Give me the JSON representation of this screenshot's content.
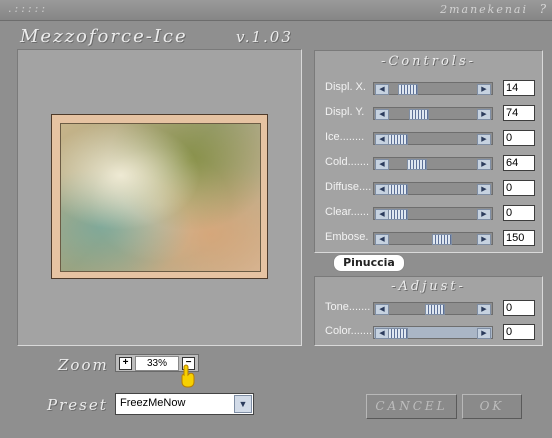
{
  "titlebar": {
    "dots": ".:::::",
    "author": "2manekenai",
    "help_symbol": "?"
  },
  "app": {
    "title": "Mezzoforce-Ice",
    "version": "v.1.03"
  },
  "controls": {
    "title": "-Controls-",
    "rows": [
      {
        "label": "Displ. X.",
        "value": "14",
        "level": 0.14
      },
      {
        "label": "Displ. Y.",
        "value": "74",
        "level": 0.29
      },
      {
        "label": "Ice........",
        "value": "0",
        "level": 0.0
      },
      {
        "label": "Cold.......",
        "value": "64",
        "level": 0.25
      },
      {
        "label": "Diffuse....",
        "value": "0",
        "level": 0.0
      },
      {
        "label": "Clear......",
        "value": "0",
        "level": 0.0
      },
      {
        "label": "Embose.",
        "value": "150",
        "level": 0.59
      }
    ]
  },
  "badge": "Pinuccia",
  "adjust": {
    "title": "-Adjust-",
    "rows": [
      {
        "label": "Tone.......",
        "value": "0",
        "level": 0.5
      },
      {
        "label": "Color.......",
        "value": "0",
        "level": 0.0
      }
    ]
  },
  "zoom": {
    "label": "Zoom",
    "value": "33%",
    "plus": "+",
    "minus": "−"
  },
  "preset": {
    "label": "Preset",
    "value": "FreezMeNow"
  },
  "buttons": {
    "cancel": "CANCEL",
    "ok": "OK"
  },
  "icons": {
    "arrow_left": "left-arrow-icon",
    "arrow_right": "right-arrow-icon",
    "hand": "pointing-hand-icon",
    "dropdown": "chevron-down-icon"
  }
}
